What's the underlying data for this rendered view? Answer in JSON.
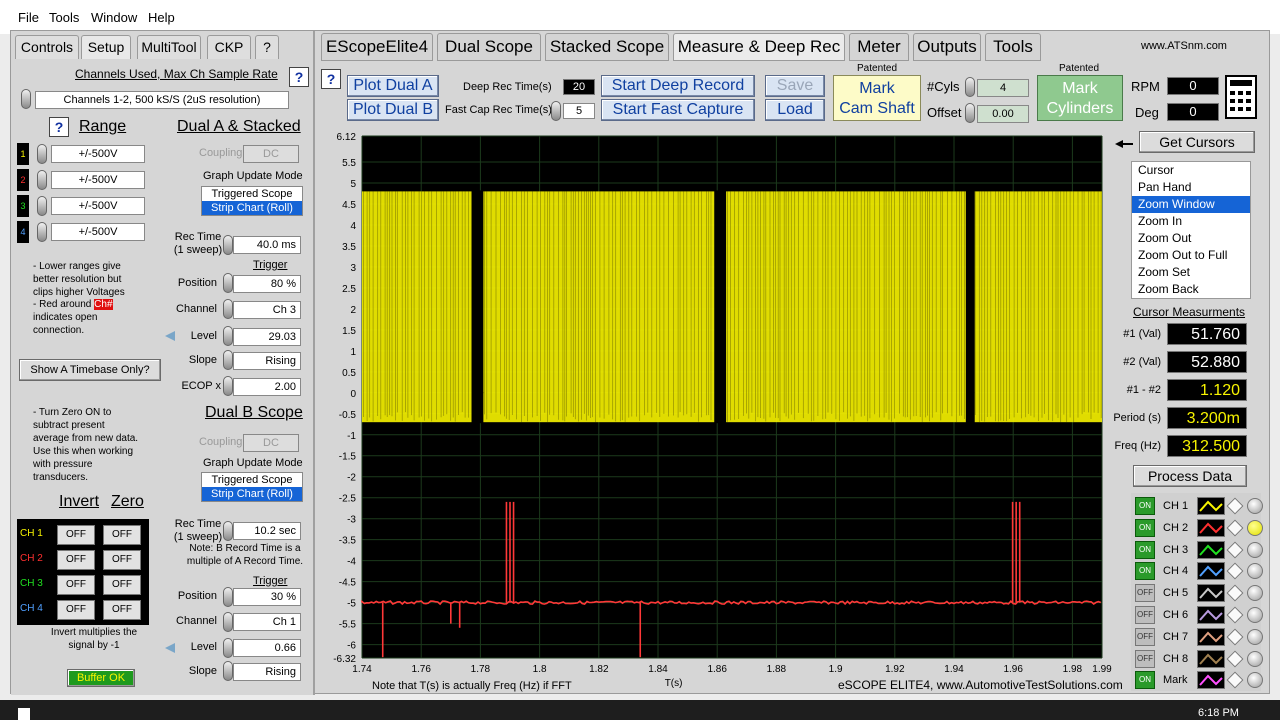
{
  "menu": [
    "File",
    "Tools",
    "Window",
    "Help"
  ],
  "left": {
    "tabs": [
      "Controls",
      "Setup",
      "MultiTool",
      "CKP",
      "?"
    ],
    "channels_used_label": "Channels Used, Max Ch Sample Rate",
    "channels_used_value": "Channels 1-2, 500 kS/S (2uS resolution)",
    "range_title": "Range",
    "ranges": [
      {
        "ch": "1",
        "value": "+/-500V",
        "color": "#f8f400"
      },
      {
        "ch": "2",
        "value": "+/-500V",
        "color": "#ff3030"
      },
      {
        "ch": "3",
        "value": "+/-500V",
        "color": "#20e020"
      },
      {
        "ch": "4",
        "value": "+/-500V",
        "color": "#50a0ff"
      }
    ],
    "range_note1": "- Lower ranges give better resolution but clips higher Voltages",
    "range_note2a": "- Red around ",
    "range_note2b": "Ch#",
    "range_note2c": "indicates open connection.",
    "timebase_btn": "Show A Timebase Only?",
    "zero_note": "- Turn Zero ON to subtract present average from new data. Use this when working with pressure transducers.",
    "invert_title": "Invert",
    "zero_title": "Zero",
    "invert_chs": [
      {
        "label": "CH 1",
        "color": "#f8f400",
        "inv": "OFF",
        "zero": "OFF"
      },
      {
        "label": "CH 2",
        "color": "#ff3030",
        "inv": "OFF",
        "zero": "OFF"
      },
      {
        "label": "CH 3",
        "color": "#20e020",
        "inv": "OFF",
        "zero": "OFF"
      },
      {
        "label": "CH 4",
        "color": "#50a0ff",
        "inv": "OFF",
        "zero": "OFF"
      }
    ],
    "invert_note": "Invert multiplies the signal by -1",
    "buffer_btn": "Buffer OK",
    "dualA": {
      "title": "Dual A & Stacked",
      "coupling_label": "Coupling",
      "coupling": "DC",
      "update_label": "Graph Update Mode",
      "mode_opts": [
        "Triggered Scope",
        "Strip Chart (Roll)"
      ],
      "rec_label": "Rec Time\n(1 sweep)",
      "rec_value": "40.0 ms",
      "trigger_label": "Trigger",
      "position_label": "Position",
      "position": "80 %",
      "channel_label": "Channel",
      "channel": "Ch 3",
      "level_label": "Level",
      "level": "29.03",
      "slope_label": "Slope",
      "slope": "Rising",
      "ecop_label": "ECOP x",
      "ecop": "2.00"
    },
    "dualB": {
      "title": "Dual B Scope",
      "coupling_label": "Coupling",
      "coupling": "DC",
      "update_label": "Graph Update Mode",
      "mode_opts": [
        "Triggered Scope",
        "Strip Chart (Roll)"
      ],
      "rec_label": "Rec Time\n(1 sweep)",
      "rec_value": "10.2 sec",
      "rec_note": "Note: B Record Time is a multiple of A Record Time.",
      "trigger_label": "Trigger",
      "position_label": "Position",
      "position": "30 %",
      "channel_label": "Channel",
      "channel": "Ch 1",
      "level_label": "Level",
      "level": "0.66",
      "slope_label": "Slope",
      "slope": "Rising"
    }
  },
  "right": {
    "tabs": [
      "EScopeElite4",
      "Dual Scope",
      "Stacked Scope",
      "Measure & Deep Rec",
      "Meter",
      "Outputs",
      "Tools"
    ],
    "website": "www.ATSnm.com",
    "plot_dual_a": "Plot Dual A",
    "plot_dual_b": "Plot Dual B",
    "deep_rec_label": "Deep Rec Time(s)",
    "deep_rec_value": "20",
    "fast_cap_label": "Fast Cap Rec Time(s)",
    "fast_cap_value": "5",
    "start_deep": "Start Deep Record",
    "start_fast": "Start Fast Capture",
    "save": "Save",
    "load": "Load",
    "patented": "Patented",
    "mark_cam": "Mark\nCam Shaft",
    "cyls_label": "#Cyls",
    "cyls_value": "4",
    "offset_label": "Offset",
    "offset_value": "0.00",
    "mark_cyl": "Mark\nCylinders",
    "rpm_label": "RPM",
    "rpm_value": "0",
    "deg_label": "Deg",
    "deg_value": "0",
    "get_cursors": "Get Cursors",
    "cursor_menu": [
      "Cursor",
      "Pan Hand",
      "Zoom Window",
      "Zoom In",
      "Zoom Out",
      "Zoom Out to Full",
      "Zoom Set",
      "Zoom Back"
    ],
    "cursor_selected": 2,
    "meas_title": "Cursor Measurments",
    "meas": [
      {
        "label": "#1 (Val)",
        "value": "51.760",
        "yellow": false
      },
      {
        "label": "#2 (Val)",
        "value": "52.880",
        "yellow": false
      },
      {
        "label": "#1 - #2",
        "value": "1.120",
        "yellow": true
      },
      {
        "label": "Period (s)",
        "value": "3.200m",
        "yellow": true
      },
      {
        "label": "Freq (Hz)",
        "value": "312.500",
        "yellow": true
      }
    ],
    "process_btn": "Process Data",
    "channels": [
      {
        "sw": "ON",
        "label": "CH 1",
        "color": "#f8f400",
        "knob": false
      },
      {
        "sw": "ON",
        "label": "CH 2",
        "color": "#ff3030",
        "knob": true
      },
      {
        "sw": "ON",
        "label": "CH 3",
        "color": "#20e020",
        "knob": false
      },
      {
        "sw": "ON",
        "label": "CH 4",
        "color": "#50a0ff",
        "knob": false
      },
      {
        "sw": "OFF",
        "label": "CH 5",
        "color": "#c8c8c8",
        "knob": false
      },
      {
        "sw": "OFF",
        "label": "CH 6",
        "color": "#b89ae0",
        "knob": false
      },
      {
        "sw": "OFF",
        "label": "CH 7",
        "color": "#e0a080",
        "knob": false
      },
      {
        "sw": "OFF",
        "label": "CH 8",
        "color": "#a08050",
        "knob": false
      },
      {
        "sw": "ON",
        "label": "Mark",
        "color": "#ff50ff",
        "knob": false
      }
    ],
    "fft_note": "Note that T(s) is actually Freq (Hz) if FFT",
    "xaxis_label": "T(s)",
    "footer": "eSCOPE ELITE4, www.AutomotiveTestSolutions.com",
    "clock": "6:18 PM"
  },
  "chart_data": {
    "type": "line",
    "xlabel": "T(s)",
    "xlim": [
      1.74,
      1.99
    ],
    "ylim": [
      -6.32,
      6.12
    ],
    "x_ticks": [
      1.74,
      1.76,
      1.78,
      1.8,
      1.82,
      1.84,
      1.86,
      1.88,
      1.9,
      1.92,
      1.94,
      1.96,
      1.98,
      1.99
    ],
    "y_ticks": [
      "6.12",
      "5.5",
      "5",
      "4.5",
      "4",
      "3.5",
      "3",
      "2.5",
      "2",
      "1.5",
      "1",
      "0.5",
      "0",
      "-0.5",
      "-1",
      "-1.5",
      "-2",
      "-2.5",
      "-3",
      "-3.5",
      "-4",
      "-4.5",
      "-5",
      "-5.5",
      "-6",
      "-6.32"
    ],
    "series": [
      {
        "color": "#f8f400",
        "high": 4.8,
        "low": -0.7,
        "gaps": [
          [
            1.777,
            1.781
          ],
          [
            1.859,
            1.863
          ],
          [
            1.944,
            1.947
          ]
        ]
      },
      {
        "color": "#ff3030",
        "baseline": -5.0,
        "spikes_up": [
          [
            1.79,
            -2.6
          ],
          [
            1.961,
            -2.6
          ]
        ],
        "spikes_down": [
          [
            1.747,
            -6.3
          ],
          [
            1.773,
            -5.6
          ],
          [
            1.77,
            -5.5
          ],
          [
            1.834,
            -6.3
          ]
        ]
      }
    ],
    "grid": true
  }
}
